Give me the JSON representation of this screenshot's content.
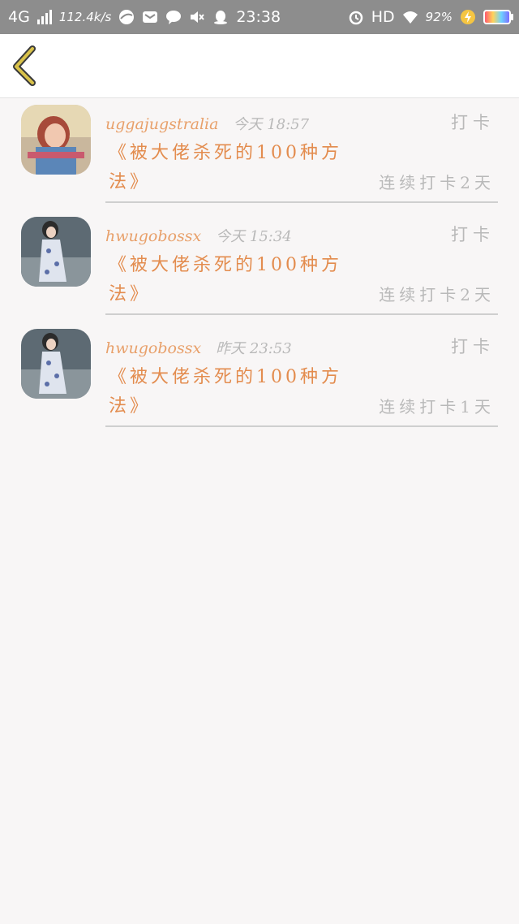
{
  "status_bar": {
    "network": "4G",
    "speed": "112.4k/s",
    "time": "23:38",
    "hd": "HD",
    "battery": "92%"
  },
  "header": {
    "back_icon": "chevron-left-icon",
    "accent_color": "#c8b23a"
  },
  "records": [
    {
      "user": "uggajugstralia",
      "time": "今天 18:57",
      "action": "打卡",
      "book": "《被大佬杀死的100种方法》",
      "streak": "连续打卡2天",
      "avatar": "girl-photo-red"
    },
    {
      "user": "hwugobossx",
      "time": "今天 15:34",
      "action": "打卡",
      "book": "《被大佬杀死的100种方法》",
      "streak": "连续打卡2天",
      "avatar": "girl-photo-qipao"
    },
    {
      "user": "hwugobossx",
      "time": "昨天 23:53",
      "action": "打卡",
      "book": "《被大佬杀死的100种方法》",
      "streak": "连续打卡1天",
      "avatar": "girl-photo-qipao"
    }
  ]
}
